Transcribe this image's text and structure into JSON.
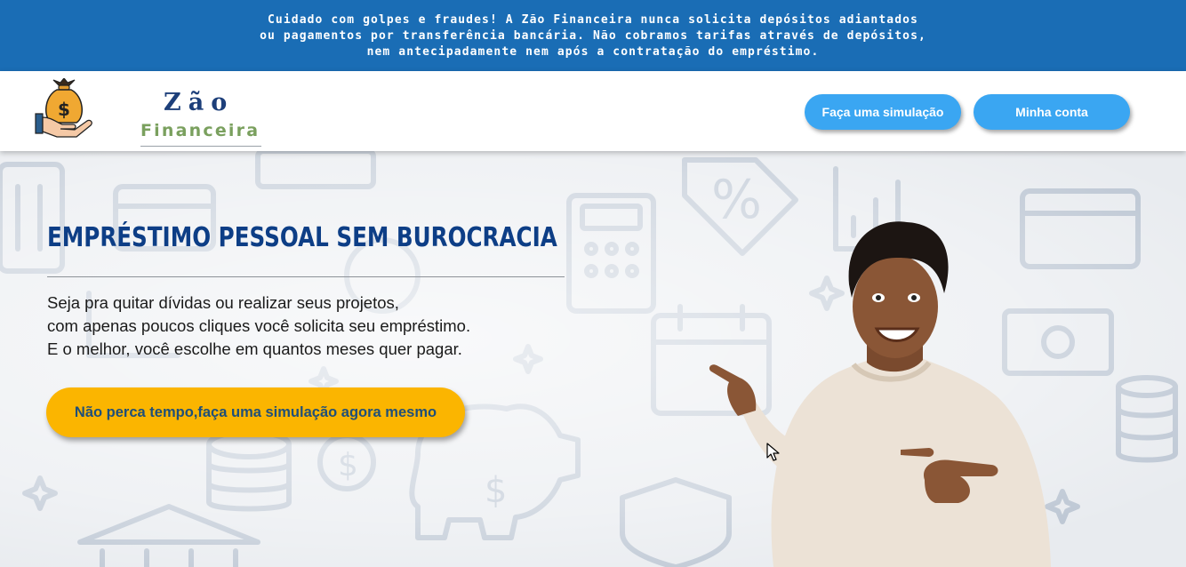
{
  "banner": {
    "lines": [
      "Cuidado com golpes e fraudes! A Zão Financeira nunca solicita depósitos adiantados",
      "ou pagamentos por transferência bancária. Não cobramos tarifas através de depósitos,",
      "nem antecipadamente nem após a contratação do empréstimo."
    ]
  },
  "header": {
    "logo": {
      "icon": "money-bag-hand-icon",
      "word1": "Zão",
      "word2": "Financeira"
    },
    "buttons": {
      "simulation": "Faça uma simulação",
      "account": "Minha conta"
    }
  },
  "hero": {
    "title": "EMPRÉSTIMO PESSOAL SEM BUROCRACIA",
    "paragraph": [
      "Seja pra quitar dívidas ou realizar seus projetos,",
      "com apenas poucos cliques você solicita seu empréstimo.",
      "E o melhor, você escolhe em quantos meses quer pagar."
    ],
    "cta": "Não perca tempo,faça uma simulação agora mesmo",
    "background_icons": [
      "card-icon",
      "calculator-icon",
      "price-tag-icon",
      "calendar-icon",
      "coins-icon",
      "piggy-bank-icon",
      "bank-icon",
      "shield-icon",
      "bar-chart-icon",
      "money-bill-icon"
    ],
    "person_image": "smiling-man-pointing-icon"
  },
  "colors": {
    "banner_bg": "#1a6db5",
    "header_button": "#3aa6f2",
    "title": "#0d3e86",
    "cta_bg": "#fbb500",
    "cta_text": "#1f4f79",
    "logo_green": "#7aa05e",
    "logo_navy": "#1d3f7a"
  }
}
